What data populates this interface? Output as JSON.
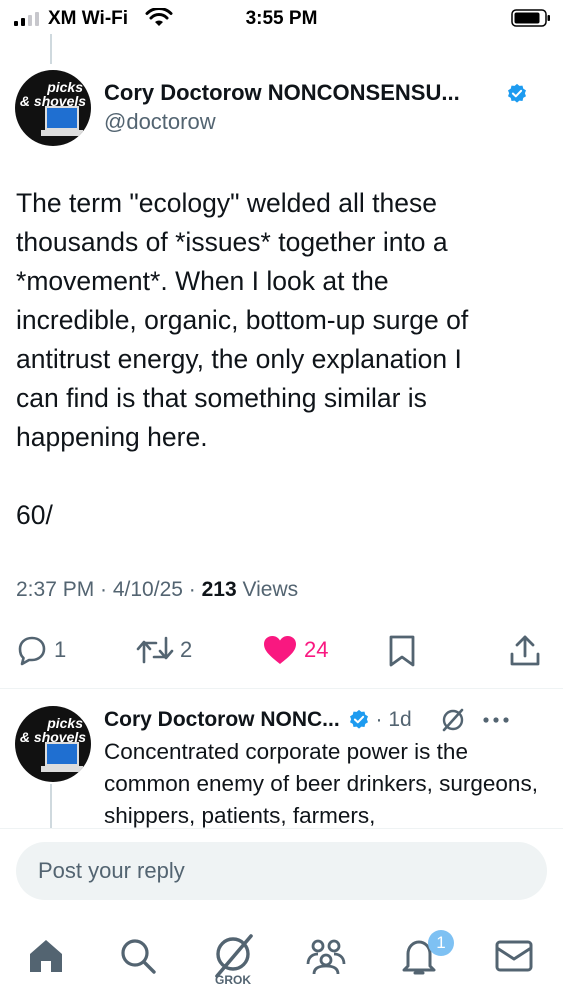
{
  "status_bar": {
    "carrier": "XM Wi-Fi",
    "time": "3:55 PM"
  },
  "main_tweet": {
    "avatar_text_line1": "picks",
    "avatar_text_line2": "& shovels",
    "author_name": "Cory Doctorow NONCONSENSU...",
    "handle": "@doctorow",
    "body_lines": [
      "The term \"ecology\" welded all these",
      "thousands of *issues* together into a",
      "*movement*. When I look at the",
      "incredible, organic, bottom-up surge of",
      "antitrust energy, the only explanation I",
      "can find is that something similar is",
      "happening here."
    ],
    "thread_number": "60/",
    "timestamp": "2:37 PM · 4/10/25 · ",
    "views_count": "213",
    "views_label": " Views"
  },
  "actions": {
    "replies": "1",
    "reposts": "2",
    "likes": "24",
    "like_color": "#f91880"
  },
  "reply_tweet": {
    "author_name": "Cory Doctorow NONC...",
    "dot": " · ",
    "time": "1d",
    "text": "Concentrated corporate power is the common enemy of beer drinkers, surgeons, shippers, patients, farmers,"
  },
  "composer": {
    "placeholder": "Post your reply"
  },
  "tabbar": {
    "grok_label": "GROK",
    "notification_count": "1"
  },
  "colors": {
    "accent": "#1d9bf0",
    "secondary_text": "#536471",
    "badge": "#7ec1f3"
  }
}
